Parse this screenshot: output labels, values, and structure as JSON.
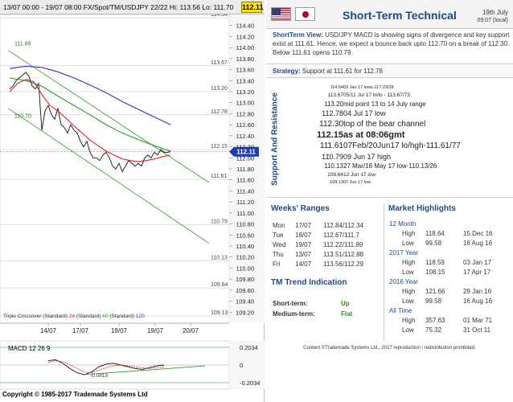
{
  "chart_header": {
    "text": "13/07 00:00 - 19/07 08:00  FX/Spot/TM/USDJPY 22/22  Hi: 113.56  Lo: 111.70",
    "last_price": "112.11"
  },
  "chart_data": {
    "type": "line",
    "title": "",
    "price_axis": {
      "ylim": [
        109.0,
        114.6
      ],
      "labels": [
        "114.40",
        "114.20",
        "114.00",
        "113.80",
        "113.60",
        "113.40",
        "113.20",
        "113.00",
        "112.80",
        "112.60",
        "112.40",
        "112.20",
        "112.00",
        "111.80",
        "111.60",
        "111.40",
        "111.20",
        "111.00",
        "110.80",
        "110.60",
        "110.40",
        "110.20",
        "110.00",
        "109.80",
        "109.60",
        "109.40",
        "109.20"
      ]
    },
    "x_labels": [
      "14/07",
      "17/07",
      "18/07",
      "19/07",
      "20/07"
    ],
    "level_labels": [
      "114.54",
      "113.67",
      "113.20",
      "112.78",
      "112.15",
      "111.61",
      "110.79",
      "110.13",
      "109.64",
      "109.13"
    ],
    "channel_labels": [
      "111.89",
      "110.70"
    ],
    "current_price_tag": "112.11",
    "legend": {
      "prefix": "Triple Crossover (Standard)",
      "items": [
        {
          "value": "24",
          "label": "(Standard)",
          "color": "#e02020"
        },
        {
          "value": "60",
          "label": "(Standard)",
          "color": "#20a020"
        },
        {
          "value": "120",
          "label": "",
          "color": "#3030c0"
        }
      ]
    },
    "series": [
      {
        "name": "price",
        "x": [
          0,
          4,
          8,
          12,
          16,
          20,
          24,
          28,
          32,
          36,
          40,
          44,
          48,
          52,
          56,
          60,
          64,
          68,
          72,
          76,
          80,
          84,
          88,
          92,
          96,
          100,
          104,
          108,
          112,
          116,
          120,
          124,
          128,
          132,
          136,
          140,
          144,
          148,
          152,
          156,
          160,
          164,
          168,
          172,
          176,
          180,
          184,
          188,
          192,
          196,
          200
        ],
        "values": [
          113.25,
          113.3,
          113.4,
          113.45,
          113.5,
          113.55,
          113.48,
          113.3,
          113.25,
          113.35,
          112.5,
          112.85,
          112.95,
          112.78,
          112.7,
          112.9,
          112.6,
          112.55,
          112.45,
          112.6,
          112.5,
          112.45,
          112.3,
          112.2,
          112.3,
          112.1,
          112.0,
          112.0,
          111.95,
          112.05,
          112.1,
          112.0,
          111.85,
          111.8,
          111.9,
          111.75,
          111.85,
          111.95,
          111.9,
          111.85,
          111.9,
          111.85,
          112.0,
          112.05,
          112.0,
          112.1,
          112.05,
          112.15,
          112.1,
          112.1,
          112.11
        ]
      },
      {
        "name": "24",
        "x": [
          0,
          10,
          20,
          30,
          40,
          50,
          60,
          70,
          80,
          90,
          100,
          110,
          120,
          130,
          140,
          150,
          160,
          170,
          180,
          190,
          200
        ],
        "values": [
          113.2,
          113.35,
          113.42,
          113.38,
          113.15,
          112.95,
          112.85,
          112.72,
          112.58,
          112.45,
          112.32,
          112.22,
          112.12,
          112.05,
          111.98,
          111.95,
          111.93,
          111.95,
          111.98,
          112.02,
          112.05
        ]
      },
      {
        "name": "60",
        "x": [
          0,
          20,
          40,
          60,
          80,
          100,
          120,
          140,
          160,
          180,
          200
        ],
        "values": [
          113.45,
          113.4,
          113.3,
          113.12,
          112.95,
          112.78,
          112.6,
          112.45,
          112.33,
          112.22,
          112.12
        ]
      },
      {
        "name": "120",
        "x": [
          0,
          20,
          40,
          60,
          80,
          100,
          120,
          140,
          160,
          180,
          200
        ],
        "values": [
          113.62,
          113.66,
          113.64,
          113.56,
          113.45,
          113.32,
          113.18,
          113.02,
          112.88,
          112.74,
          112.6
        ]
      }
    ],
    "macd": {
      "label": "MACD 12 26 9",
      "axis_labels": [
        "0.2034",
        "0",
        "-0.2034"
      ],
      "marker": "-0.0813"
    }
  },
  "copyright": "Copyright © 1985-2017 Trademade Systems Ltd",
  "header": {
    "title": "Short-Term Technical",
    "date": "19th July",
    "time": "09:07 (local)"
  },
  "view": {
    "label": "ShortTerm View:",
    "text": "USD/JPY MACD is showing signs of divergence and key support exist at 111.61. Hence, we expect a bounce back upto 112.70 on a break of 112.30. Below 111.61 opens 110.79"
  },
  "strategy": {
    "label": "Strategy:",
    "text": "Support at 111.61 for 112.78"
  },
  "support_resistance": {
    "title": "Support And Resistance",
    "rows": [
      {
        "level": "114.54",
        "note": "03 Jan 17 lows-117.23/28",
        "star": "",
        "size": 5.5
      },
      {
        "level": "113.67",
        "note": "05/11 Jul 17 hi/lo - 113.67/73",
        "star": "",
        "size": 6.5
      },
      {
        "level": "113.20",
        "note": "mid point 13 to 14 July range",
        "star": "",
        "size": 8
      },
      {
        "level": "112.78",
        "note": "04 Jul 17 low",
        "star": "",
        "size": 9
      },
      {
        "level": "112.30",
        "note": "top of the bear channel",
        "star": "*",
        "size": 10
      },
      {
        "level": "112.15",
        "note": "as at 08:06gmt",
        "star": "",
        "size": 11
      },
      {
        "level": "111.61",
        "note": "07Feb/20Jun17 lo/hgh-111.61/77",
        "star": "*",
        "size": 10
      },
      {
        "level": "110.79",
        "note": "09 Jun 17 high",
        "star": "*",
        "size": 9
      },
      {
        "level": "110.13",
        "note": "27 Mar/18 May 17 low-110.13/26",
        "star": "",
        "size": 8
      },
      {
        "level": "109.64",
        "note": "12 Jun 17 low",
        "star": "",
        "size": 6.5
      },
      {
        "level": "109.13",
        "note": "07 Jun 17 low",
        "star": "",
        "size": 5.5
      }
    ]
  },
  "weeks_ranges": {
    "title": "Weeks' Ranges",
    "rows": [
      {
        "day": "Mon",
        "date": "17/07",
        "range": "112.84/112.34"
      },
      {
        "day": "Tue",
        "date": "18/07",
        "range": "112.67/111.7"
      },
      {
        "day": "Wed",
        "date": "19/07",
        "range": "112.22/111.89"
      },
      {
        "day": "Thu",
        "date": "13/07",
        "range": "113.51/112.88"
      },
      {
        "day": "Fri",
        "date": "14/07",
        "range": "113.56/112.29"
      }
    ]
  },
  "trend": {
    "title": "TM Trend Indication",
    "rows": [
      {
        "label": "Short-term:",
        "value": "Up"
      },
      {
        "label": "Medium-term:",
        "value": "Flat"
      }
    ]
  },
  "market_highlights": {
    "title": "Market Highlights",
    "sections": [
      {
        "name": "12 Month",
        "rows": [
          {
            "k": "High",
            "v": "118.64",
            "d": "15 Dec 16"
          },
          {
            "k": "Low",
            "v": "99.58",
            "d": "16 Aug 16"
          }
        ]
      },
      {
        "name": "2017 Year",
        "rows": [
          {
            "k": "High",
            "v": "118.59",
            "d": "03 Jan 17"
          },
          {
            "k": "Low",
            "v": "108.15",
            "d": "17 Apr 17"
          }
        ]
      },
      {
        "name": "2016 Year",
        "rows": [
          {
            "k": "High",
            "v": "121.66",
            "d": "29 Jan 16"
          },
          {
            "k": "Low",
            "v": "99.58",
            "d": "16 Aug 16"
          }
        ]
      },
      {
        "name": "All Time",
        "rows": [
          {
            "k": "High",
            "v": "357.63",
            "d": "01 Mar 71"
          },
          {
            "k": "Low",
            "v": "75.32",
            "d": "31 Oct 11"
          }
        ]
      }
    ]
  },
  "footer": "Content ©Trademade Systems Ltd., 2017 reproduction / redistribution prohibited."
}
